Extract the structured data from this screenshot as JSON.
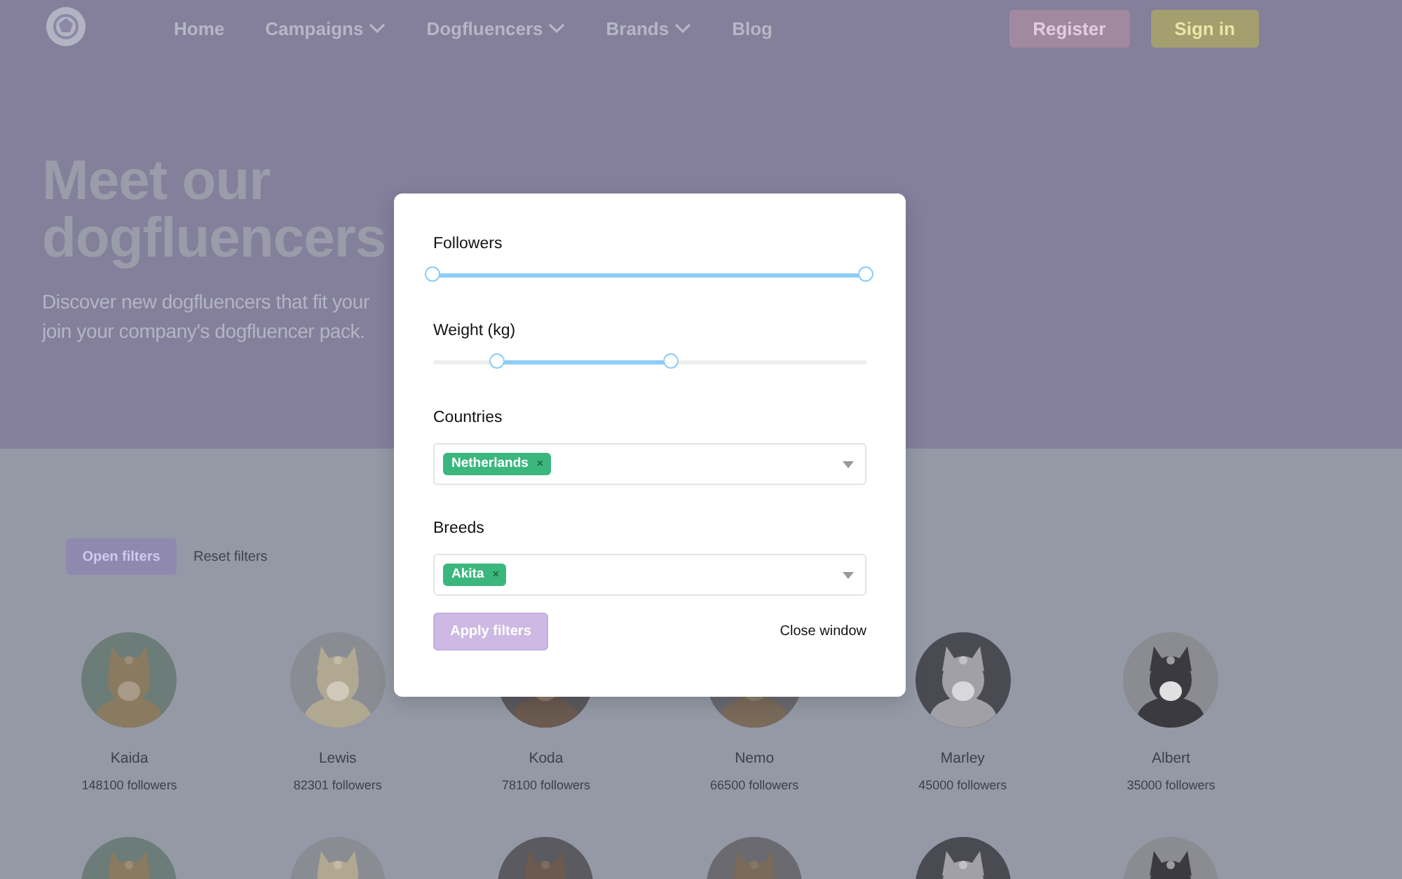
{
  "nav": {
    "links": [
      {
        "label": "Home",
        "dropdown": false
      },
      {
        "label": "Campaigns",
        "dropdown": true
      },
      {
        "label": "Dogfluencers",
        "dropdown": true
      },
      {
        "label": "Brands",
        "dropdown": true
      },
      {
        "label": "Blog",
        "dropdown": false
      }
    ],
    "buttons": [
      {
        "label": "Register",
        "kind": "register"
      },
      {
        "label": "Sign in",
        "kind": "signin"
      }
    ]
  },
  "hero": {
    "title": [
      "Meet our",
      "dogfluencers"
    ],
    "subtitle": [
      "Discover new dogfluencers that fit your",
      "join your company's dogfluencer pack."
    ]
  },
  "toolbar": {
    "open_filters": "Open filters",
    "reset_filters": "Reset filters"
  },
  "dogs": [
    {
      "kind": "profile",
      "name": "Kaida",
      "followers": "148100 followers"
    },
    {
      "kind": "profile",
      "name": "Lewis",
      "followers": "82301 followers"
    },
    {
      "kind": "profile",
      "name": "Koda",
      "followers": "78100 followers"
    },
    {
      "kind": "profile",
      "name": "Nemo",
      "followers": "66500 followers"
    },
    {
      "kind": "profile",
      "name": "Marley",
      "followers": "45000 followers"
    },
    {
      "kind": "profile",
      "name": "Albert",
      "followers": "35000 followers"
    },
    {
      "kind": "picture"
    },
    {
      "kind": "picture"
    },
    {
      "kind": "picture"
    },
    {
      "kind": "picture"
    },
    {
      "kind": "picture"
    },
    {
      "kind": "picture"
    }
  ],
  "modal": {
    "sliders": [
      {
        "label": "Followers",
        "thumbs": [
          {
            "level": 0
          },
          {
            "level": 1
          }
        ]
      },
      {
        "label": "Weight (kg)",
        "thumbs": [
          {
            "level": 0.15
          },
          {
            "level": 0.55
          }
        ]
      }
    ],
    "selects": [
      {
        "label": "Countries",
        "tags": [
          {
            "label": "Netherlands",
            "remove": "×"
          }
        ]
      },
      {
        "label": "Breeds",
        "tags": [
          {
            "label": "Akita",
            "remove": "×"
          }
        ]
      }
    ],
    "apply_button": "Apply filters",
    "close_link": "Close window"
  }
}
